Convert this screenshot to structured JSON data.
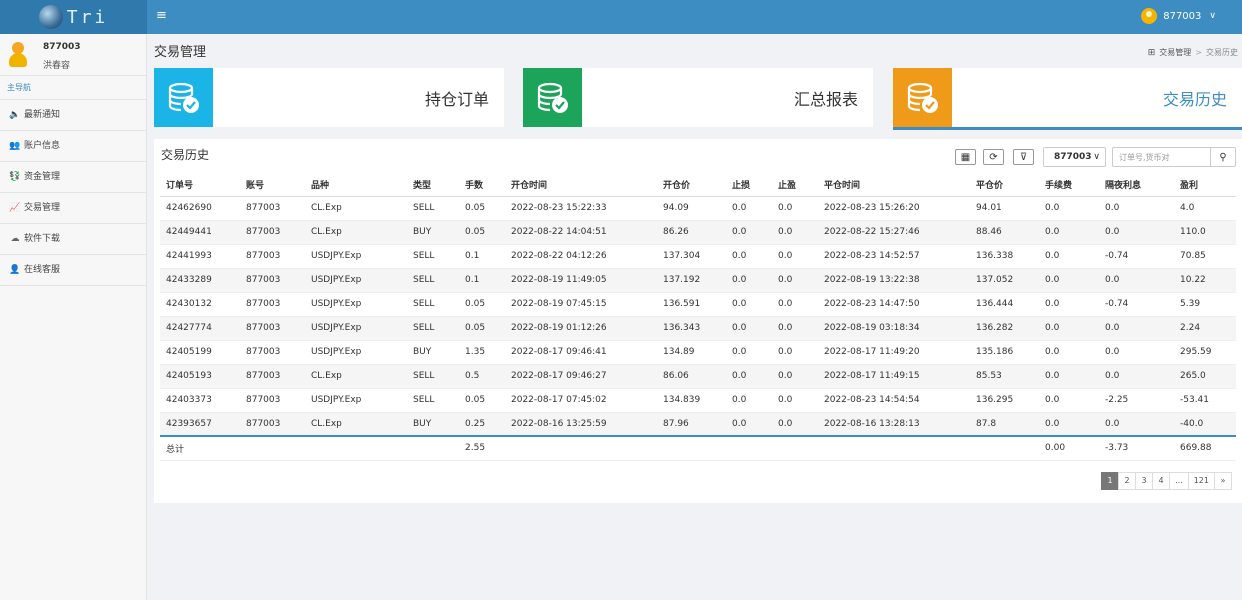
{
  "app": {
    "logo_text": "Tri"
  },
  "topbar": {
    "menu_icon": "≡",
    "user_id": "877003"
  },
  "sidebar": {
    "user_id": "877003",
    "user_name": "洪春容",
    "nav_title": "主导航",
    "items": [
      {
        "label": "最新通知",
        "icon": "announce-icon",
        "glyph": "🔈"
      },
      {
        "label": "账户信息",
        "icon": "user-card-icon",
        "glyph": "👥"
      },
      {
        "label": "资金管理",
        "icon": "money-icon",
        "glyph": "💱"
      },
      {
        "label": "交易管理",
        "icon": "trade-icon",
        "glyph": "📈"
      },
      {
        "label": "软件下载",
        "icon": "cloud-download-icon",
        "glyph": "☁"
      },
      {
        "label": "在线客服",
        "icon": "support-icon",
        "glyph": "👤"
      }
    ]
  },
  "page": {
    "title": "交易管理"
  },
  "breadcrumb": {
    "parent": "交易管理",
    "separator": ">",
    "current": "交易历史"
  },
  "cards": [
    {
      "label": "持仓订单",
      "color": "#1bb4e6"
    },
    {
      "label": "汇总报表",
      "color": "#1ba45a"
    },
    {
      "label": "交易历史",
      "color": "#f09a1a"
    }
  ],
  "panel": {
    "title": "交易历史",
    "account_select": "877003",
    "search_placeholder": "订单号,货币对"
  },
  "table": {
    "headers": [
      "订单号",
      "账号",
      "品种",
      "类型",
      "手数",
      "开仓时间",
      "开仓价",
      "止损",
      "止盈",
      "平仓时间",
      "平仓价",
      "手续费",
      "隔夜利息",
      "盈利"
    ],
    "rows": [
      [
        "42462690",
        "877003",
        "CL.Exp",
        "SELL",
        "0.05",
        "2022-08-23 15:22:33",
        "94.09",
        "0.0",
        "0.0",
        "2022-08-23 15:26:20",
        "94.01",
        "0.0",
        "0.0",
        "4.0"
      ],
      [
        "42449441",
        "877003",
        "CL.Exp",
        "BUY",
        "0.05",
        "2022-08-22 14:04:51",
        "86.26",
        "0.0",
        "0.0",
        "2022-08-22 15:27:46",
        "88.46",
        "0.0",
        "0.0",
        "110.0"
      ],
      [
        "42441993",
        "877003",
        "USDJPY.Exp",
        "SELL",
        "0.1",
        "2022-08-22 04:12:26",
        "137.304",
        "0.0",
        "0.0",
        "2022-08-23 14:52:57",
        "136.338",
        "0.0",
        "-0.74",
        "70.85"
      ],
      [
        "42433289",
        "877003",
        "USDJPY.Exp",
        "SELL",
        "0.1",
        "2022-08-19 11:49:05",
        "137.192",
        "0.0",
        "0.0",
        "2022-08-19 13:22:38",
        "137.052",
        "0.0",
        "0.0",
        "10.22"
      ],
      [
        "42430132",
        "877003",
        "USDJPY.Exp",
        "SELL",
        "0.05",
        "2022-08-19 07:45:15",
        "136.591",
        "0.0",
        "0.0",
        "2022-08-23 14:47:50",
        "136.444",
        "0.0",
        "-0.74",
        "5.39"
      ],
      [
        "42427774",
        "877003",
        "USDJPY.Exp",
        "SELL",
        "0.05",
        "2022-08-19 01:12:26",
        "136.343",
        "0.0",
        "0.0",
        "2022-08-19 03:18:34",
        "136.282",
        "0.0",
        "0.0",
        "2.24"
      ],
      [
        "42405199",
        "877003",
        "USDJPY.Exp",
        "BUY",
        "1.35",
        "2022-08-17 09:46:41",
        "134.89",
        "0.0",
        "0.0",
        "2022-08-17 11:49:20",
        "135.186",
        "0.0",
        "0.0",
        "295.59"
      ],
      [
        "42405193",
        "877003",
        "CL.Exp",
        "SELL",
        "0.5",
        "2022-08-17 09:46:27",
        "86.06",
        "0.0",
        "0.0",
        "2022-08-17 11:49:15",
        "85.53",
        "0.0",
        "0.0",
        "265.0"
      ],
      [
        "42403373",
        "877003",
        "USDJPY.Exp",
        "SELL",
        "0.05",
        "2022-08-17 07:45:02",
        "134.839",
        "0.0",
        "0.0",
        "2022-08-23 14:54:54",
        "136.295",
        "0.0",
        "-2.25",
        "-53.41"
      ],
      [
        "42393657",
        "877003",
        "CL.Exp",
        "BUY",
        "0.25",
        "2022-08-16 13:25:59",
        "87.96",
        "0.0",
        "0.0",
        "2022-08-16 13:28:13",
        "87.8",
        "0.0",
        "0.0",
        "-40.0"
      ]
    ],
    "total": {
      "label": "总计",
      "lots": "2.55",
      "fee": "0.00",
      "swap": "-3.73",
      "profit": "669.88"
    }
  },
  "pagination": {
    "pages": [
      "1",
      "2",
      "3",
      "4",
      "...",
      "121",
      "»"
    ],
    "active": "1"
  }
}
